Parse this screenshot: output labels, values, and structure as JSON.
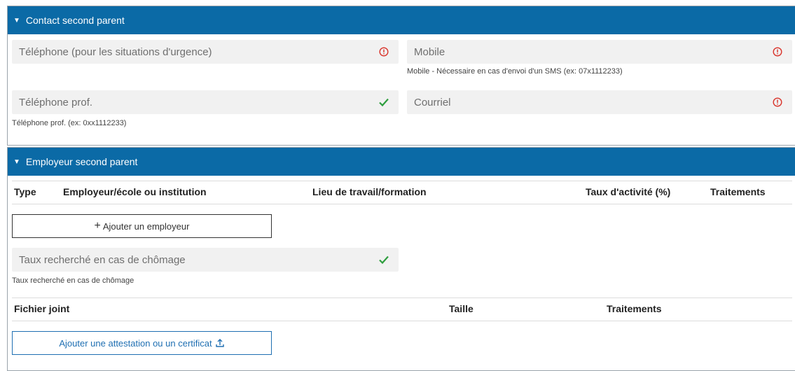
{
  "contact": {
    "header": "Contact second parent",
    "phone_urgency": {
      "placeholder": "Téléphone (pour les situations d'urgence)",
      "status": "warning"
    },
    "mobile": {
      "placeholder": "Mobile",
      "status": "warning",
      "hint": "Mobile - Nécessaire en cas d'envoi d'un SMS (ex: 07x1112233)"
    },
    "phone_prof": {
      "placeholder": "Téléphone prof.",
      "status": "valid",
      "hint": "Téléphone prof. (ex: 0xx1112233)"
    },
    "email": {
      "placeholder": "Courriel",
      "status": "warning"
    }
  },
  "employer": {
    "header": "Employeur second parent",
    "columns": [
      "Type",
      "Employeur/école ou institution",
      "Lieu de travail/formation",
      "Taux d'activité (%)",
      "Traitements"
    ],
    "add_employer_label": "Ajouter un employeur",
    "unemployment_rate": {
      "placeholder": "Taux recherché en cas de chômage",
      "status": "valid",
      "hint": "Taux recherché en cas de chômage"
    },
    "file_columns": [
      "Fichier joint",
      "Taille",
      "Traitements"
    ],
    "add_attestation_label": "Ajouter une attestation ou un certificat"
  },
  "colors": {
    "header_bg": "#0b6aa6",
    "warning": "#d9342b",
    "valid": "#2e9e3e",
    "link": "#1f6fb2"
  }
}
